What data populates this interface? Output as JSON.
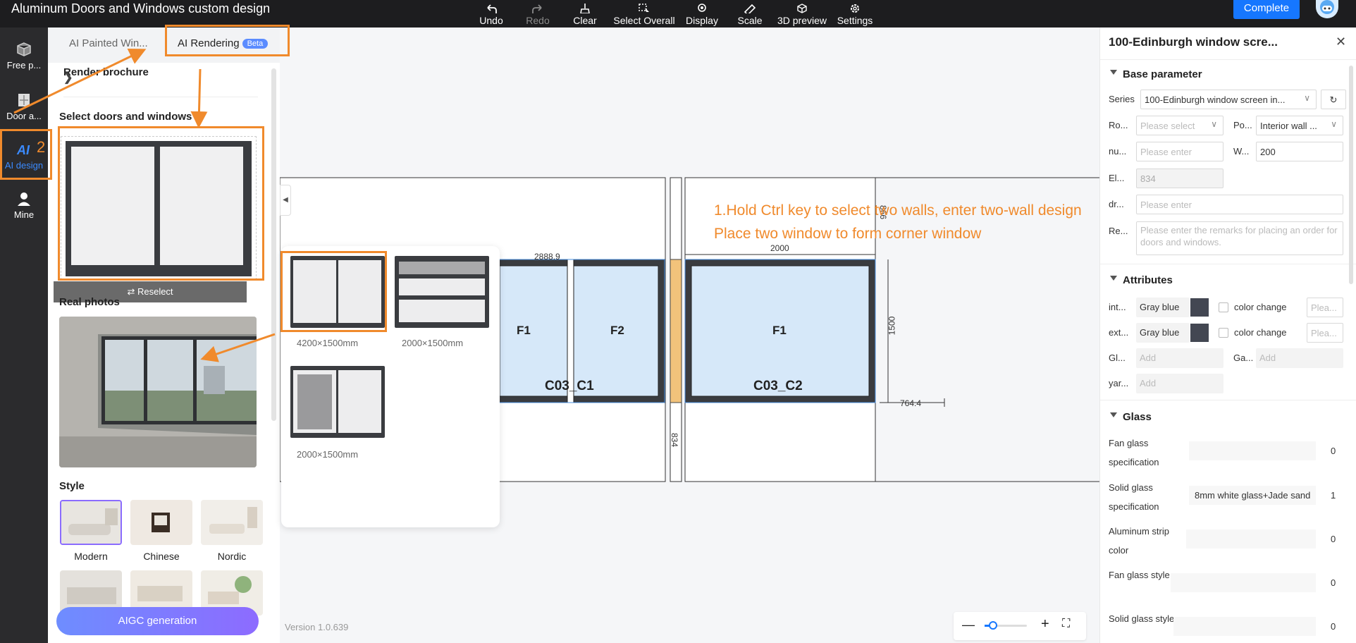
{
  "app": {
    "title": "Aluminum Doors and Windows custom design"
  },
  "toolbar": {
    "undo": "Undo",
    "redo": "Redo",
    "clear": "Clear",
    "select_overall": "Select Overall",
    "display": "Display",
    "scale": "Scale",
    "preview_3d": "3D preview",
    "settings": "Settings",
    "complete": "Complete"
  },
  "leftnav": {
    "items": [
      {
        "label": "Free p...",
        "icon": "box-icon"
      },
      {
        "label": "Door a...",
        "icon": "door-icon"
      },
      {
        "label": "AI design",
        "icon": "ai-icon"
      },
      {
        "label": "Mine",
        "icon": "user-icon"
      }
    ]
  },
  "panel": {
    "tabs": [
      "AI Painted Win...",
      "AI Rendering"
    ],
    "beta": "Beta",
    "render_brochure": "Render brochure",
    "select_title": "Select doors and windows",
    "reselect": "Reselect",
    "real_photos": "Real photos",
    "style_title": "Style",
    "styles": [
      "Modern",
      "Chinese",
      "Nordic"
    ],
    "aigc": "AIGC generation"
  },
  "popup": {
    "templates": [
      "4200×1500mm",
      "2000×1500mm",
      "2000×1500mm"
    ]
  },
  "canvas": {
    "dim_top_left": "2888.9",
    "dim_top_right": "2000",
    "dim_height": "1500",
    "dim_vertical_top": "866",
    "dim_vertical_bottom": "834",
    "dim_right": "764.4",
    "labels": [
      "F1",
      "F2",
      "F1"
    ],
    "codes": [
      "C03_C1",
      "C03_C2"
    ],
    "annotation_step1_line1": "1.Hold Ctrl key to select two walls, enter two-wall design",
    "annotation_step1_line2": "Place two window to form corner window",
    "annotation_step2": "2",
    "version": "Version 1.0.639"
  },
  "right": {
    "title": "100-Edinburgh window scre...",
    "base_parameter": "Base parameter",
    "series_label": "Series",
    "series_value": "100-Edinburgh window screen in...",
    "ro_label": "Ro...",
    "ro_placeholder": "Please select",
    "po_label": "Po...",
    "po_value": "Interior wall ...",
    "nu_label": "nu...",
    "nu_placeholder": "Please enter",
    "w_label": "W...",
    "w_value": "200",
    "el_label": "El...",
    "el_value": "834",
    "dr_label": "dr...",
    "dr_placeholder": "Please enter",
    "re_label": "Re...",
    "re_placeholder": "Please enter the remarks for placing an order for doors and windows.",
    "attributes": "Attributes",
    "int_label": "int...",
    "int_value": "Gray blue",
    "ext_label": "ext...",
    "ext_value": "Gray blue",
    "color_change": "color change",
    "color_placeholder": "Plea...",
    "gl_label": "Gl...",
    "ga_label": "Ga...",
    "yar_label": "yar...",
    "add": "Add",
    "glass": "Glass",
    "glass_rows": [
      {
        "label": "Fan glass specification",
        "value": "",
        "num": "0"
      },
      {
        "label": "Solid glass specification",
        "value": "8mm white glass+Jade sand",
        "num": "1"
      },
      {
        "label": "Aluminum strip color",
        "value": "",
        "num": "0"
      },
      {
        "label": "Fan glass style",
        "value": "",
        "num": "0"
      },
      {
        "label": "Solid glass style",
        "value": "",
        "num": "0"
      }
    ]
  },
  "colors": {
    "accent": "#1677ff",
    "annotation": "#f08a2c",
    "frame": "#434752",
    "glass": "#d6e8f9"
  }
}
